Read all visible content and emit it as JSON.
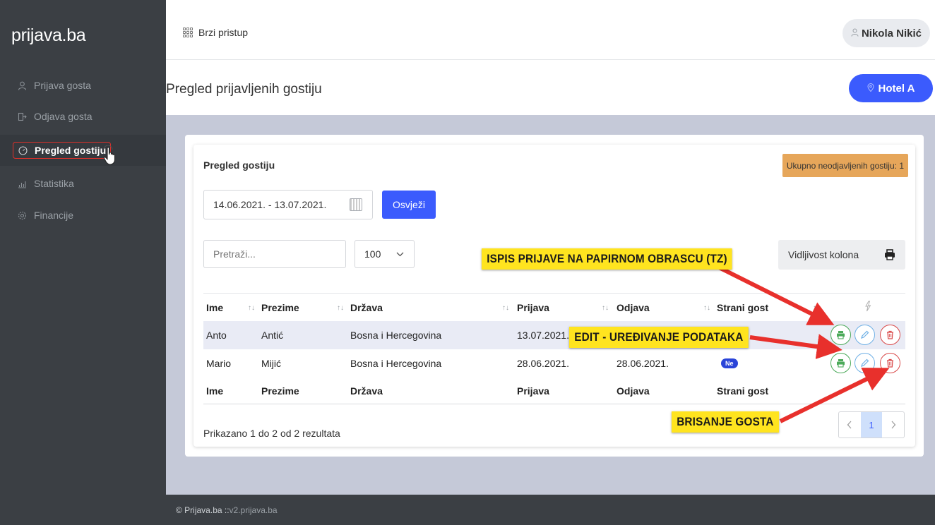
{
  "app": {
    "brand": "prijava.ba",
    "quick_access": "Brzi pristup",
    "user_name": "Nikola Nikić",
    "hotel": "Hotel A",
    "page_title": "Pregled prijavljenih gostiju"
  },
  "sidebar": {
    "items": [
      {
        "label": "Prijava gosta",
        "icon": "user-icon"
      },
      {
        "label": "Odjava gosta",
        "icon": "logout-icon"
      },
      {
        "label": "Pregled gostiju",
        "icon": "dashboard-icon",
        "active": true
      },
      {
        "label": "Statistika",
        "icon": "chart-icon"
      },
      {
        "label": "Financije",
        "icon": "gear-icon"
      }
    ]
  },
  "card": {
    "title": "Pregled gostiju",
    "unchecked_badge": "Ukupno neodjavljenih gostiju: 1",
    "date_range": "14.06.2021. - 13.07.2021.",
    "refresh_label": "Osvježi",
    "search_placeholder": "Pretraži...",
    "page_size": "100",
    "columns_button": "Vidljivost kolona",
    "results_info": "Prikazano 1 do 2 od 2 rezultata",
    "current_page": "1"
  },
  "table": {
    "headers": [
      "Ime",
      "Prezime",
      "Država",
      "Prijava",
      "Odjava",
      "Strani gost"
    ],
    "rows": [
      {
        "ime": "Anto",
        "prezime": "Antić",
        "drzava": "Bosna i Hercegovina",
        "prijava": "13.07.2021.",
        "odjava": "",
        "strani": ""
      },
      {
        "ime": "Mario",
        "prezime": "Mijić",
        "drzava": "Bosna i Hercegovina",
        "prijava": "28.06.2021.",
        "odjava": "28.06.2021.",
        "strani": "Ne"
      }
    ]
  },
  "annotations": {
    "print": "ISPIS PRIJAVE NA PAPIRNOM OBRASCU (TZ)",
    "edit": "EDIT - UREĐIVANJE PODATAKA",
    "delete": "BRISANJE GOSTA"
  },
  "footer": {
    "left": "© Prijava.ba :: ",
    "right": "v2.prijava.ba"
  },
  "colors": {
    "accent": "#3b5bfd",
    "sidebar": "#3b3f44",
    "content_bg": "#c5c9d8",
    "badge": "#e6a65a",
    "callout": "#ffe41f",
    "arrow": "#e8302c"
  }
}
